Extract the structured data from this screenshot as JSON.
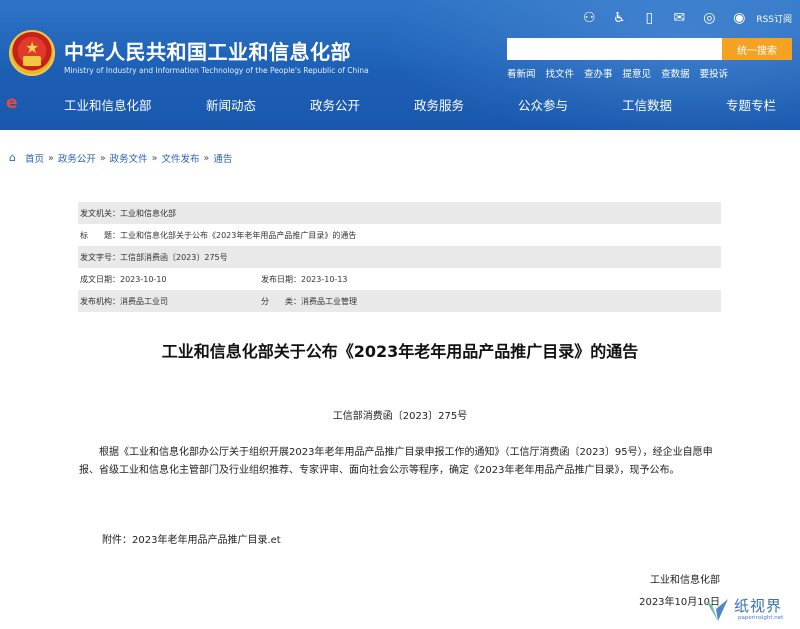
{
  "header": {
    "title": "中华人民共和国工业和信息化部",
    "subtitle": "Ministry of Industry and Information Technology of the People's Republic of China",
    "top_icons": [
      "accessibility-elderly-icon",
      "wheelchair-icon",
      "mobile-icon",
      "mail-icon",
      "wechat-icon",
      "weibo-icon"
    ],
    "rss_label": "RSS订阅",
    "search": {
      "placeholder": "",
      "button_label": "统一搜索"
    },
    "quick_links": [
      "看新闻",
      "找文件",
      "查办事",
      "提意见",
      "查数据",
      "要投诉"
    ]
  },
  "nav": {
    "items": [
      "工业和信息化部",
      "新闻动态",
      "政务公开",
      "政务服务",
      "公众参与",
      "工信数据",
      "专题专栏"
    ]
  },
  "breadcrumb": [
    "首页",
    "政务公开",
    "政务文件",
    "文件发布",
    "通告"
  ],
  "meta": {
    "issuer_label": "发文机关：",
    "issuer": "工业和信息化部",
    "title_label": "标　　题：",
    "title": "工业和信息化部关于公布《2023年老年用品产品推广目录》的通告",
    "docno_label": "发文字号：",
    "docno": "工信部消费函〔2023〕275号",
    "written_label": "成文日期：",
    "written": "2023-10-10",
    "published_label": "发布日期：",
    "published": "2023-10-13",
    "org_label": "发布机构：",
    "org": "消费品工业司",
    "category_label": "分　　类：",
    "category": "消费品工业管理"
  },
  "document": {
    "title": "工业和信息化部关于公布《2023年老年用品产品推广目录》的通告",
    "number": "工信部消费函〔2023〕275号",
    "body": "根据《工业和信息化部办公厅关于组织开展2023年老年用品产品推广目录申报工作的通知》（工信厅消费函〔2023〕95号），经企业自愿申报、省级工业和信息化主管部门及行业组织推荐、专家评审、面向社会公示等程序，确定《2023年老年用品产品推广目录》，现予公布。",
    "attachment_label": "附件：",
    "attachment_name": "2023年老年用品产品推广目录.et",
    "signature": "工业和信息化部",
    "date": "2023年10月10日"
  },
  "watermark": {
    "text": "纸视界",
    "url": "paperinsight.net"
  },
  "colors": {
    "header_blue": "#1c5fb5",
    "search_orange": "#f3a321",
    "link_blue": "#2a63b8",
    "emblem_red": "#c7221a"
  }
}
